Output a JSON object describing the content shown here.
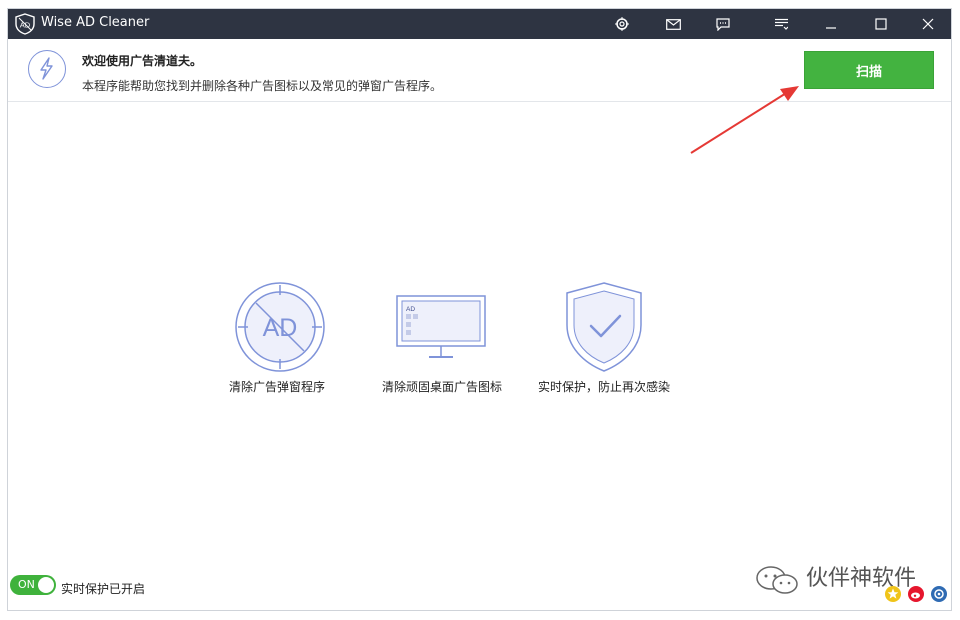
{
  "window": {
    "title": "Wise AD Cleaner"
  },
  "header": {
    "welcome_title": "欢迎使用广告清道夫。",
    "welcome_desc": "本程序能帮助您找到并删除各种广告图标以及常见的弹窗广告程序。",
    "scan_label": "扫描"
  },
  "features": [
    {
      "label": "清除广告弹窗程序",
      "icon": "ad-block-icon"
    },
    {
      "label": "清除顽固桌面广告图标",
      "icon": "desktop-monitor-icon"
    },
    {
      "label": "实时保护，防止再次感染",
      "icon": "shield-check-icon"
    }
  ],
  "monitor_badge": "AD",
  "circle_badge": "AD",
  "footer": {
    "toggle_label": "ON",
    "realtime_label": "实时保护已开启"
  },
  "watermark": "伙伴神软件",
  "colors": {
    "titlebar": "#2e3442",
    "accent_green": "#43b340",
    "icon_blue": "#7f93d9",
    "arrow_red": "#e53935"
  }
}
